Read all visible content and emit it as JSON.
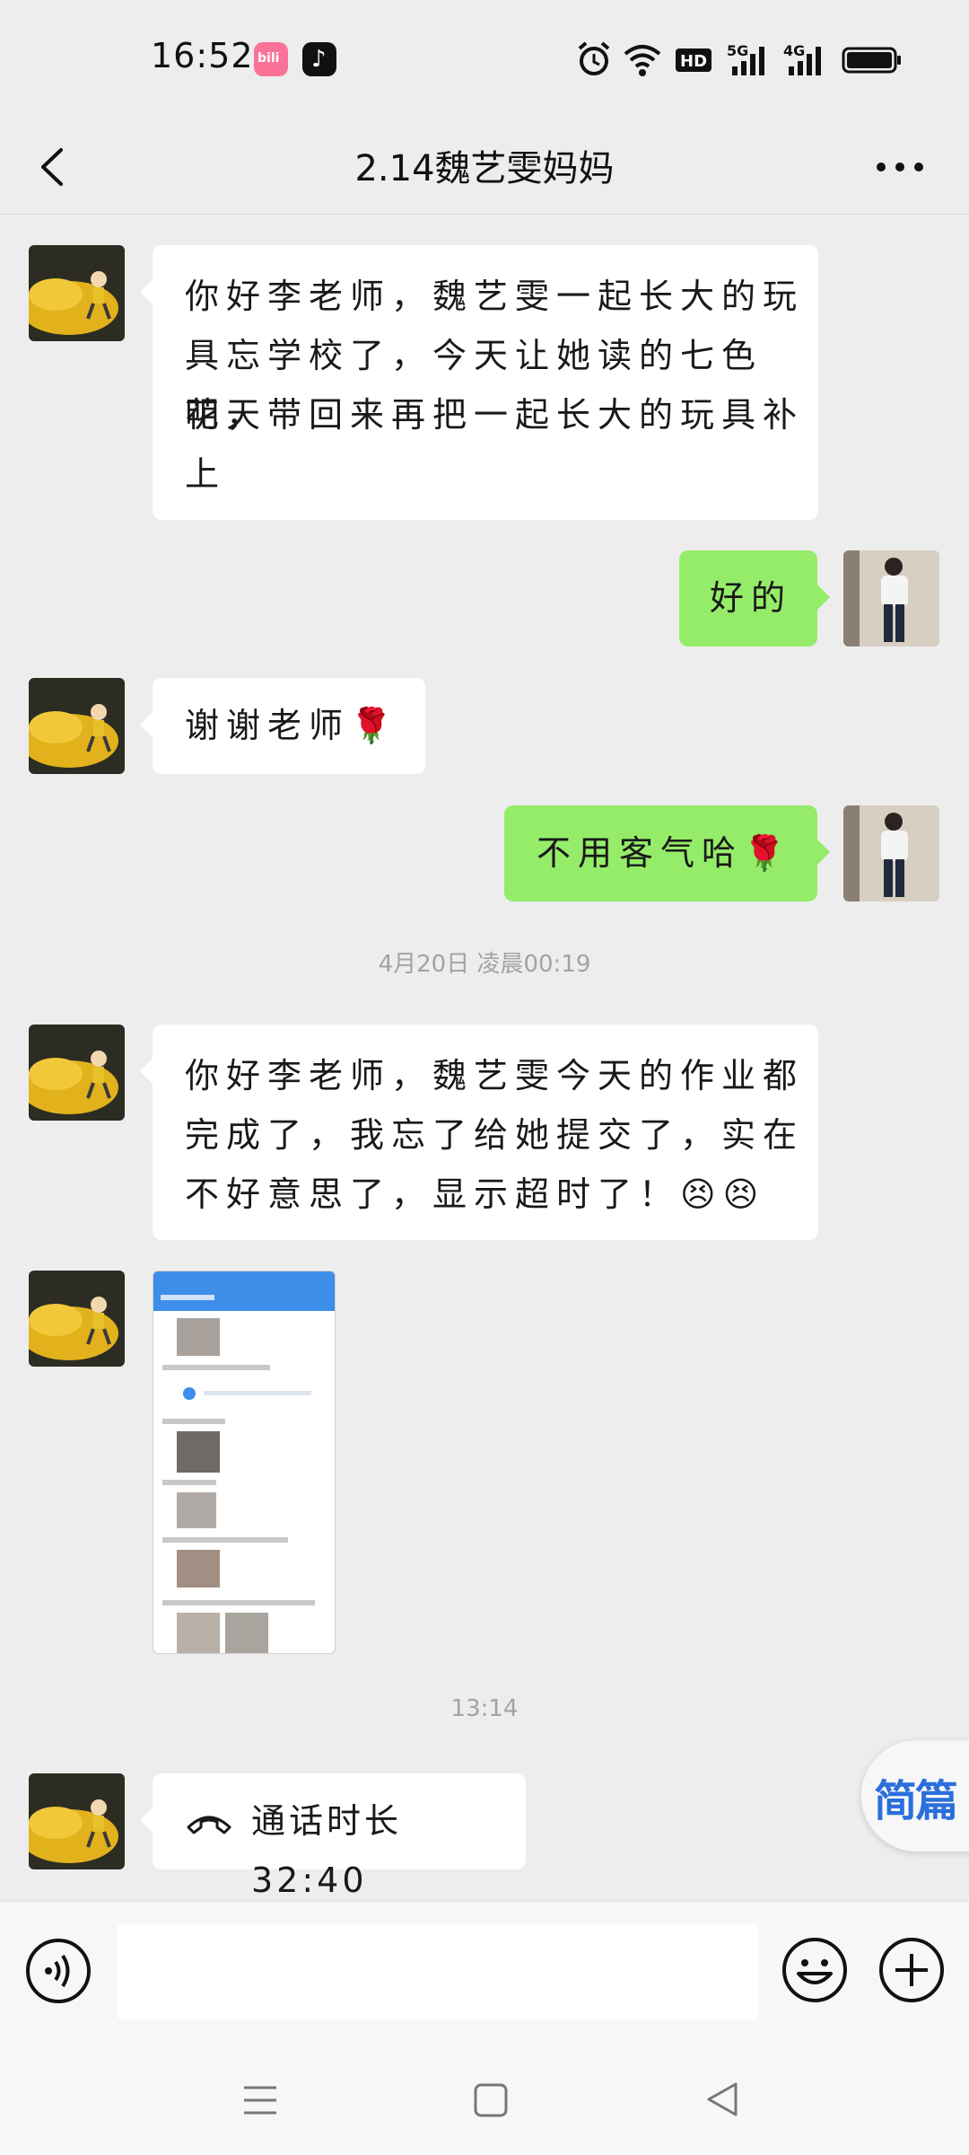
{
  "status_bar": {
    "time": "16:52",
    "apps": [
      "bilibili-icon",
      "tiktok-icon"
    ],
    "indicators": [
      "alarm-icon",
      "wifi-icon",
      "hd-icon",
      "5g-signal-icon",
      "4g-signal-icon",
      "battery-icon"
    ]
  },
  "header": {
    "back_icon": "chevron-left-icon",
    "title": "2.14魏艺雯妈妈",
    "more_icon": "ellipsis-icon"
  },
  "messages": [
    {
      "side": "left",
      "type": "text",
      "lines": [
        "你好李老师，魏艺雯一起长大的玩",
        "具忘学校了，今天让她读的七色花，",
        "明天带回来再把一起长大的玩具补",
        "上"
      ]
    },
    {
      "side": "right",
      "type": "text",
      "text": "好的"
    },
    {
      "side": "left",
      "type": "text",
      "text": "谢谢老师🌹"
    },
    {
      "side": "right",
      "type": "text",
      "text": "不用客气哈🌹"
    },
    {
      "type": "time",
      "text": "4月20日 凌晨00:19"
    },
    {
      "side": "left",
      "type": "text",
      "lines": [
        "你好李老师，魏艺雯今天的作业都",
        "完成了，我忘了给她提交了，实在",
        "不好意思了，显示超时了！😣😣"
      ]
    },
    {
      "side": "left",
      "type": "image",
      "description_icon": "screenshot-thumbnail"
    },
    {
      "type": "time",
      "text": "13:14"
    },
    {
      "side": "left",
      "type": "call",
      "icon": "phone-icon",
      "text": "通话时长 32:40"
    }
  ],
  "input_bar": {
    "voice_icon": "voice-icon",
    "placeholder": "",
    "emoji_icon": "emoji-icon",
    "plus_icon": "plus-icon"
  },
  "floating_widget": {
    "label": "简篇"
  },
  "nav_bar": {
    "icons": [
      "menu-icon",
      "home-icon",
      "back-triangle-icon"
    ]
  },
  "colors": {
    "background": "#ededed",
    "outgoing_bubble": "#95ec69",
    "incoming_bubble": "#ffffff",
    "timestamp": "#a3a3a3",
    "widget_text": "#2a6fdb"
  }
}
